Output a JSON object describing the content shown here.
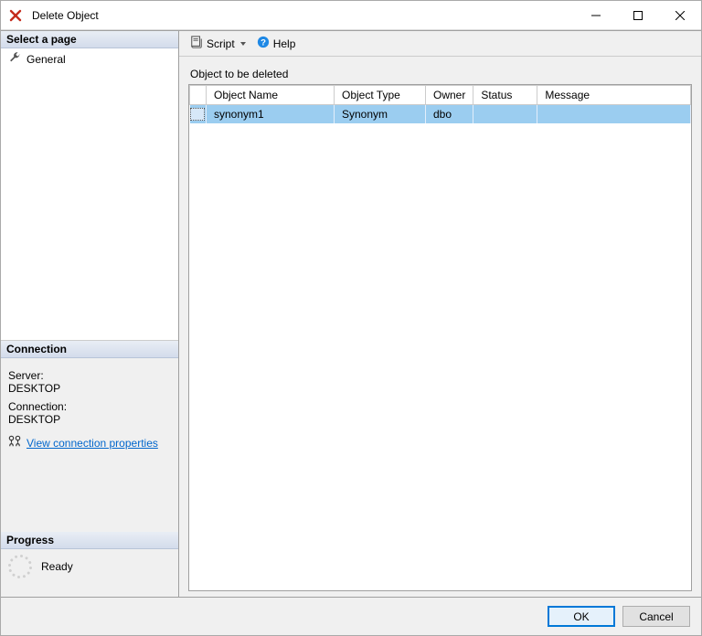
{
  "window": {
    "title": "Delete Object"
  },
  "sidebar": {
    "select_page_header": "Select a page",
    "pages": [
      {
        "label": "General"
      }
    ],
    "connection_header": "Connection",
    "server_label": "Server:",
    "server_value": "DESKTOP",
    "connection_label": "Connection:",
    "connection_value": "DESKTOP",
    "view_props_link": "View connection properties",
    "progress_header": "Progress",
    "progress_status": "Ready"
  },
  "toolbar": {
    "script_label": "Script",
    "help_label": "Help"
  },
  "content": {
    "section_label": "Object to be deleted",
    "columns": {
      "object_name": "Object Name",
      "object_type": "Object Type",
      "owner": "Owner",
      "status": "Status",
      "message": "Message"
    },
    "rows": [
      {
        "object_name": "synonym1",
        "object_type": "Synonym",
        "owner": "dbo",
        "status": "",
        "message": ""
      }
    ]
  },
  "footer": {
    "ok_label": "OK",
    "cancel_label": "Cancel"
  }
}
